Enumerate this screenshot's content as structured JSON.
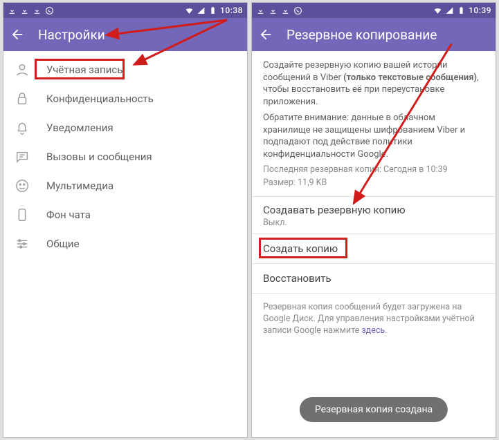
{
  "status": {
    "time": "10:38",
    "time_right": "10:39"
  },
  "left": {
    "title": "Настройки",
    "items": [
      {
        "label": "Учётная запись"
      },
      {
        "label": "Конфиденциальность"
      },
      {
        "label": "Уведомления"
      },
      {
        "label": "Вызовы и сообщения"
      },
      {
        "label": "Мультимедиа"
      },
      {
        "label": "Фон чата"
      },
      {
        "label": "Общие"
      }
    ]
  },
  "right": {
    "title": "Резервное копирование",
    "desc_pre": "Создайте резервную копию вашей истории сообщений в Viber ",
    "desc_bold": "(только текстовые сообщения)",
    "desc_post": ", чтобы восстановить её при переустановке приложения.",
    "warn": "Обратите внимание: данные в облачном хранилище не защищены шифрованием Viber и подпадают под действие политики конфиденциальности Google.",
    "last_backup": "Последняя резервная копия: Сегодня в 10:39",
    "size": "Размер: 11,9 KB",
    "make_backup_title": "Создавать резервную копию",
    "make_backup_sub": "Выкл.",
    "create_copy": "Создать копию",
    "restore": "Восстановить",
    "footer_pre": "Резервная копия сообщений будет загружена на Google Диск. Для управления настройками учётной записи Google нажмите ",
    "footer_link": "здесь",
    "footer_post": ".",
    "toast": "Резервная копия создана"
  }
}
